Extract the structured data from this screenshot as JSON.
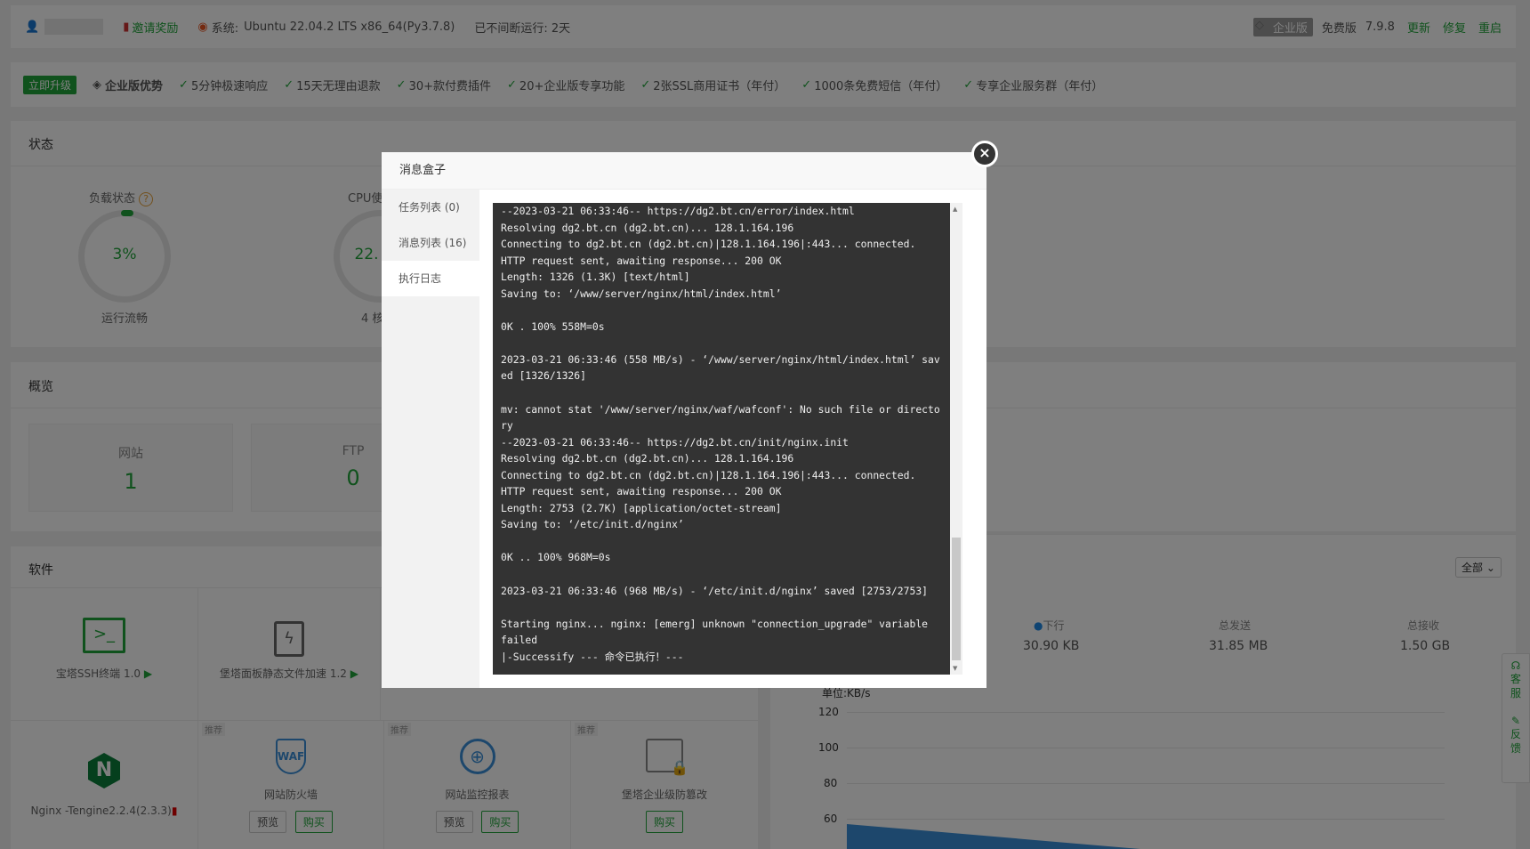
{
  "topbar": {
    "invite": "邀请奖励",
    "system_label": "系统:",
    "system_value": "Ubuntu 22.04.2 LTS x86_64(Py3.7.8)",
    "uptime": "已不间断运行: 2天",
    "edition_badge": "企业版",
    "free_label": "免费版",
    "version": "7.9.8",
    "update": "更新",
    "repair": "修复",
    "restart": "重启"
  },
  "promo": {
    "upgrade": "立即升级",
    "title": "企业版优势",
    "features": [
      "5分钟极速响应",
      "15天无理由退款",
      "30+款付费插件",
      "20+企业版专享功能",
      "2张SSL商用证书（年付）",
      "1000条免费短信（年付）",
      "专享企业服务群（年付）"
    ]
  },
  "status": {
    "title": "状态",
    "load_label": "负载状态",
    "load_value": "3%",
    "load_state": "运行流畅",
    "load_pct": 3,
    "cpu_label": "CPU使",
    "cpu_value": "22.",
    "cpu_cores": "4 核"
  },
  "overview": {
    "title": "概览",
    "site_label": "网站",
    "site_value": "1",
    "ftp_label": "FTP",
    "ftp_value": "0"
  },
  "software": {
    "title": "软件",
    "filter": "全部",
    "ssh": "宝塔SSH终端 1.0",
    "static": "堡塔面板静态文件加速 1.2",
    "nginx": "Nginx -Tengine2.2.4(2.3.3)",
    "rec_tag": "推荐",
    "waf_icon_text": "WAF",
    "waf": "网站防火墙",
    "monitor": "网站监控报表",
    "tamper": "堡塔企业级防篡改",
    "preview": "预览",
    "buy": "购买"
  },
  "traffic": {
    "down_label": "下行",
    "down_value": "30.90 KB",
    "sent_label": "总发送",
    "sent_value": "31.85 MB",
    "recv_label": "总接收",
    "recv_value": "1.50 GB",
    "unit": "单位:KB/s",
    "ticks": [
      "120",
      "100",
      "80",
      "60"
    ]
  },
  "float": {
    "service": "客服",
    "feedback": "反馈"
  },
  "modal": {
    "title": "消息盒子",
    "tabs": [
      "任务列表 (0)",
      "消息列表 (16)",
      "执行日志"
    ],
    "log": "--2023-03-21 06:33:46-- https://dg2.bt.cn/error/index.html\nResolving dg2.bt.cn (dg2.bt.cn)... 128.1.164.196\nConnecting to dg2.bt.cn (dg2.bt.cn)|128.1.164.196|:443... connected.\nHTTP request sent, awaiting response... 200 OK\nLength: 1326 (1.3K) [text/html]\nSaving to: ‘/www/server/nginx/html/index.html’\n\n0K . 100% 558M=0s\n\n2023-03-21 06:33:46 (558 MB/s) - ‘/www/server/nginx/html/index.html’ saved [1326/1326]\n\nmv: cannot stat '/www/server/nginx/waf/wafconf': No such file or directory\n--2023-03-21 06:33:46-- https://dg2.bt.cn/init/nginx.init\nResolving dg2.bt.cn (dg2.bt.cn)... 128.1.164.196\nConnecting to dg2.bt.cn (dg2.bt.cn)|128.1.164.196|:443... connected.\nHTTP request sent, awaiting response... 200 OK\nLength: 2753 (2.7K) [application/octet-stream]\nSaving to: ‘/etc/init.d/nginx’\n\n0K .. 100% 968M=0s\n\n2023-03-21 06:33:46 (968 MB/s) - ‘/etc/init.d/nginx’ saved [2753/2753]\n\nStarting nginx... nginx: [emerg] unknown \"connection_upgrade\" variable\nfailed\n|-Successify --- 命令已执行！---"
  }
}
